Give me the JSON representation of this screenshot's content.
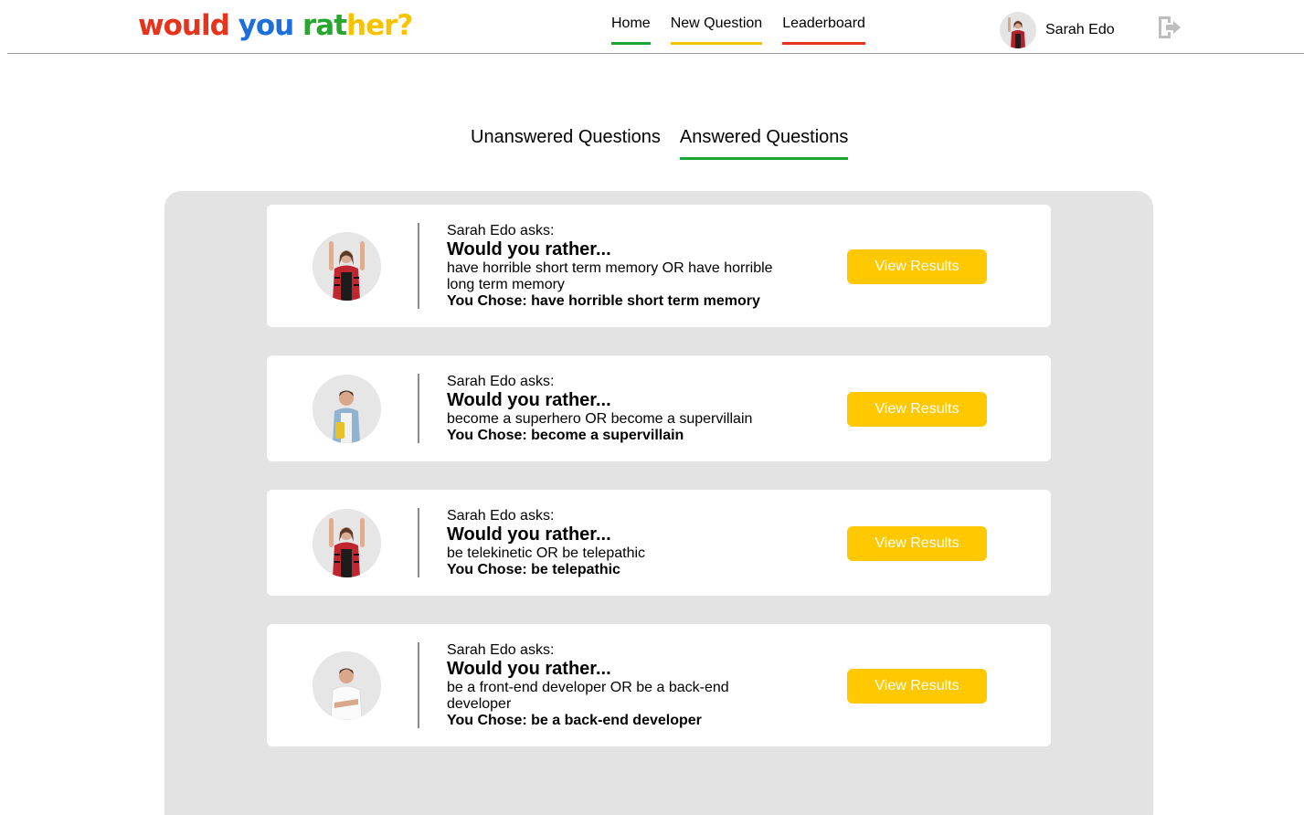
{
  "app": {
    "logo": {
      "text": "would you rather?",
      "parts": [
        {
          "text": "would",
          "color": "#e8331c"
        },
        {
          "text": " ",
          "color": "#000000"
        },
        {
          "text": "you",
          "color": "#1e6fd9"
        },
        {
          "text": " ",
          "color": "#000000"
        },
        {
          "text": "rat",
          "color": "#2aa630"
        },
        {
          "text": "her?",
          "color": "#f7c300"
        }
      ]
    }
  },
  "nav": {
    "items": [
      {
        "label": "Home",
        "color": "#1aa532"
      },
      {
        "label": "New Question",
        "color": "#f5c400"
      },
      {
        "label": "Leaderboard",
        "color": "#e8331c"
      }
    ]
  },
  "user": {
    "name": "Sarah Edo",
    "logout_icon": "logout-icon"
  },
  "tabs": [
    {
      "label": "Unanswered Questions",
      "active": false
    },
    {
      "label": "Answered Questions",
      "active": true
    }
  ],
  "questions": [
    {
      "author": "Sarah Edo asks:",
      "heading": "Would you rather...",
      "options": "have horrible short term memory OR have horrible long term memory",
      "chosen": "You Chose: have horrible short term memory",
      "button": "View Results",
      "avatar": "woman-red-plaid"
    },
    {
      "author": "Sarah Edo asks:",
      "heading": "Would you rather...",
      "options": "become a superhero OR become a supervillain",
      "chosen": "You Chose: become a supervillain",
      "button": "View Results",
      "avatar": "student-denim"
    },
    {
      "author": "Sarah Edo asks:",
      "heading": "Would you rather...",
      "options": "be telekinetic OR be telepathic",
      "chosen": "You Chose: be telepathic",
      "button": "View Results",
      "avatar": "woman-red-plaid"
    },
    {
      "author": "Sarah Edo asks:",
      "heading": "Would you rather...",
      "options": "be a front-end developer OR be a back-end developer",
      "chosen": "You Chose: be a back-end developer",
      "button": "View Results",
      "avatar": "man-white-shirt"
    }
  ],
  "colors": {
    "accent": "#ffc800",
    "active_tab": "#1aa532",
    "panel": "#e3e3e3"
  }
}
